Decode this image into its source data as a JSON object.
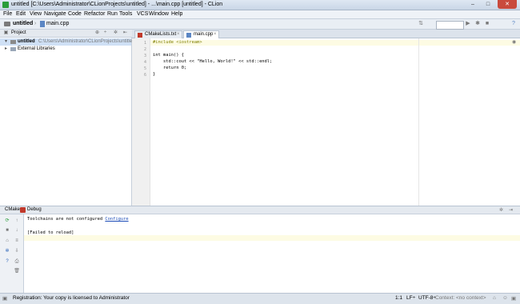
{
  "window": {
    "title": "untitled [C:\\Users\\Administrator\\CLionProjects\\untitled] - ...\\main.cpp [untitled] - CLion",
    "close": "✕"
  },
  "menu": [
    "File",
    "Edit",
    "View",
    "Navigate",
    "Code",
    "Refactor",
    "Run",
    "Tools",
    "VCS",
    "Window",
    "Help"
  ],
  "toolbar": {
    "project": "untitled",
    "file": "main.cpp"
  },
  "project_panel": {
    "label": "Project",
    "tree": [
      {
        "name": "untitled",
        "path": "C:\\Users\\Administrator\\CLionProjects\\untitled"
      },
      {
        "name": "External Libraries",
        "path": ""
      }
    ]
  },
  "tabs": [
    {
      "label": "CMakeLists.txt",
      "active": false
    },
    {
      "label": "main.cpp",
      "active": true
    }
  ],
  "editor": {
    "line_numbers": [
      "1",
      "2",
      "3",
      "4",
      "5",
      "6"
    ],
    "lines": [
      "#include <iostream>",
      "",
      "int main() {",
      "    std::cout << \"Hello, World!\" << std::endl;",
      "    return 0;",
      "}"
    ]
  },
  "bottom_panel": {
    "tabs": [
      "CMake",
      "Debug"
    ],
    "console": {
      "line1_text": "Toolchains are not configured ",
      "line1_link": "Configure",
      "line2": "[Failed to reload]"
    }
  },
  "statusbar": {
    "message": "Registration: Your copy is licensed to Administrator",
    "position": "1:1",
    "line_sep": "LF÷",
    "encoding": "UTF-8÷",
    "context": "Context: <no context>"
  },
  "colors": {
    "accent": "#2a9d3a",
    "selection": "#cfe0f5",
    "current_line": "#fdfbe3"
  }
}
